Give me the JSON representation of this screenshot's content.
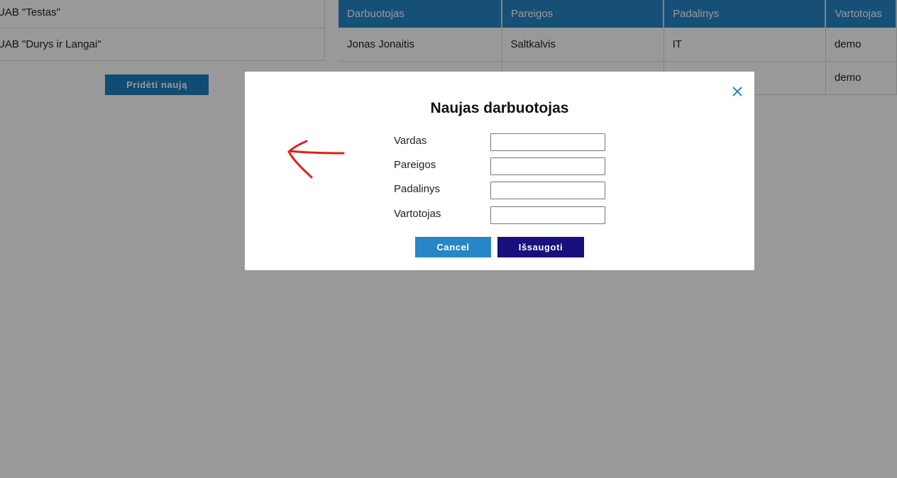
{
  "companies": {
    "items": [
      "UAB \"Testas\"",
      "UAB \"Durys ir Langai\""
    ],
    "add_button_label": "Pridėti naują"
  },
  "employees": {
    "headers": [
      "Darbuotojas",
      "Pareigos",
      "Padalinys",
      "Vartotojas"
    ],
    "rows": [
      [
        "Jonas Jonaitis",
        "Saltkalvis",
        "IT",
        "demo"
      ],
      [
        "",
        "",
        "",
        "demo"
      ]
    ]
  },
  "modal": {
    "title": "Naujas darbuotojas",
    "fields": [
      {
        "label": "Vardas",
        "value": ""
      },
      {
        "label": "Pareigos",
        "value": ""
      },
      {
        "label": "Padalinys",
        "value": ""
      },
      {
        "label": "Vartotojas",
        "value": ""
      }
    ],
    "cancel_label": "Cancel",
    "save_label": "Išsaugoti",
    "close_icon": "close-icon"
  },
  "colors": {
    "accent": "#2686c7",
    "save": "#17107d",
    "annotation": "#e02020"
  }
}
